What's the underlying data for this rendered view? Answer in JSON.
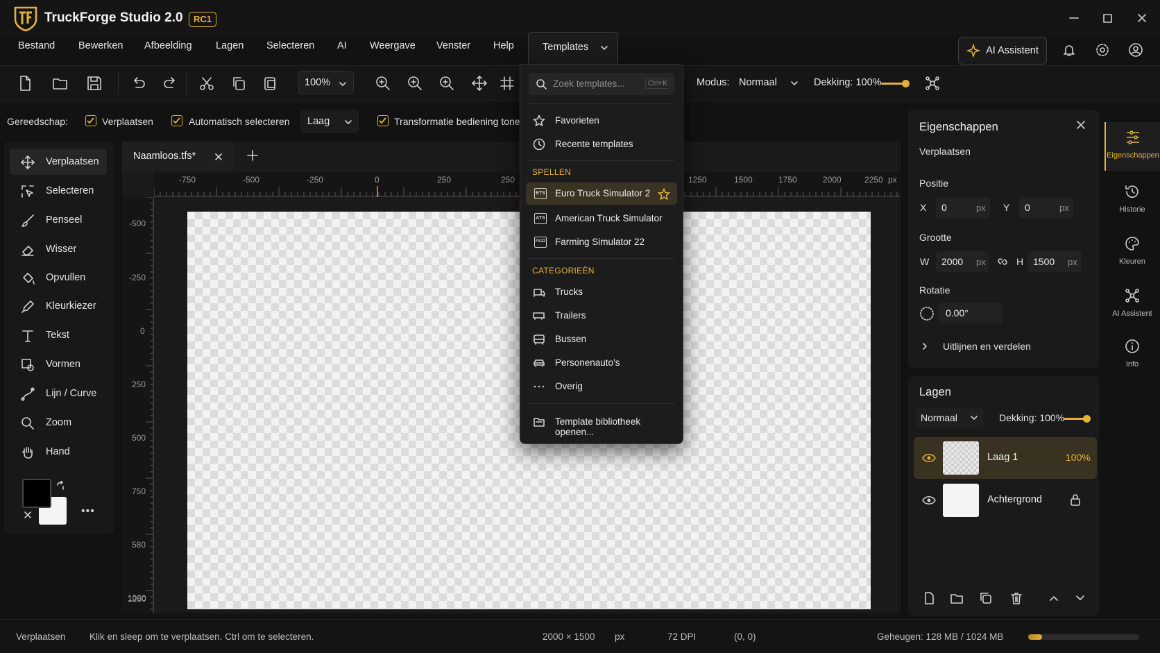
{
  "app": {
    "title": "TruckForge Studio 2.0",
    "badge": "RC1"
  },
  "menu": {
    "items": [
      "Bestand",
      "Bewerken",
      "Afbeelding",
      "Lagen",
      "Selecteren",
      "AI",
      "Weergave",
      "Venster",
      "Help"
    ],
    "templates_label": "Templates",
    "ai_assistant_label": "AI Assistent"
  },
  "toolbar": {
    "zoom_value": "100%",
    "modus_label": "Modus:",
    "modus_value": "Normaal",
    "dekking_label": "Dekking:",
    "dekking_value": "100%",
    "dekking_level": 1.0
  },
  "options": {
    "tool_label": "Gereedschap:",
    "move_label": "Verplaatsen",
    "auto_select_label": "Automatisch selecteren",
    "target_value": "Laag",
    "transform_label": "Transformatie bediening tonen"
  },
  "tools": [
    {
      "label": "Verplaatsen",
      "icon": "move-icon",
      "active": true
    },
    {
      "label": "Selecteren",
      "icon": "select-icon",
      "active": false
    },
    {
      "label": "Penseel",
      "icon": "brush-icon",
      "active": false
    },
    {
      "label": "Wisser",
      "icon": "eraser-icon",
      "active": false
    },
    {
      "label": "Opvullen",
      "icon": "fill-icon",
      "active": false
    },
    {
      "label": "Kleurkiezer",
      "icon": "eyedropper-icon",
      "active": false
    },
    {
      "label": "Tekst",
      "icon": "text-icon",
      "active": false
    },
    {
      "label": "Vormen",
      "icon": "shapes-icon",
      "active": false
    },
    {
      "label": "Lijn / Curve",
      "icon": "curve-icon",
      "active": false
    },
    {
      "label": "Zoom",
      "icon": "zoom-icon",
      "active": false
    },
    {
      "label": "Hand",
      "icon": "hand-icon",
      "active": false
    }
  ],
  "colors": {
    "foreground": "#000000",
    "background": "#f4f4f4",
    "accent": "#e5b13a"
  },
  "document": {
    "tab_label": "Naamloos.tfs*",
    "h_ruler": [
      "-750",
      "-500",
      "-250",
      "0",
      "250",
      "250",
      "1250",
      "1500",
      "1750",
      "2000",
      "2250"
    ],
    "h_ruler_unit": "px",
    "v_ruler": [
      "-500",
      "-250",
      "0",
      "250",
      "500",
      "750",
      "580",
      "1000",
      "1250"
    ]
  },
  "templates_dropdown": {
    "search_placeholder": "Zoek templates...",
    "shortcut": "Ctrl+K",
    "quick": [
      {
        "label": "Favorieten",
        "icon": "star-icon"
      },
      {
        "label": "Recente templates",
        "icon": "clock-icon"
      }
    ],
    "games_heading": "SPELLEN",
    "games": [
      {
        "label": "Euro Truck Simulator 2",
        "abbr": "ETS",
        "highlighted": true
      },
      {
        "label": "American Truck Simulator",
        "abbr": "ATS",
        "highlighted": false
      },
      {
        "label": "Farming Simulator 22",
        "abbr": "FS22",
        "highlighted": false
      }
    ],
    "categories_heading": "CATEGORIEËN",
    "categories": [
      {
        "label": "Trucks",
        "icon": "truck-icon"
      },
      {
        "label": "Trailers",
        "icon": "trailer-icon"
      },
      {
        "label": "Bussen",
        "icon": "bus-icon"
      },
      {
        "label": "Personenauto's",
        "icon": "car-icon"
      },
      {
        "label": "Overig",
        "icon": "more-icon"
      }
    ],
    "open_library_label": "Template bibliotheek openen..."
  },
  "properties": {
    "title": "Eigenschappen",
    "tool_name": "Verplaatsen",
    "position_label": "Positie",
    "x_label": "X",
    "x_value": "0",
    "y_label": "Y",
    "y_value": "0",
    "size_label": "Grootte",
    "w_label": "W",
    "w_value": "2000",
    "h_label": "H",
    "h_value": "1500",
    "unit": "px",
    "rotation_label": "Rotatie",
    "rotation_value": "0.00°",
    "align_label": "Uitlijnen en verdelen"
  },
  "layers": {
    "title": "Lagen",
    "blend_mode": "Normaal",
    "opacity_label": "Dekking:",
    "opacity_value": "100%",
    "items": [
      {
        "name": "Laag 1",
        "opacity": "100%",
        "selected": true
      },
      {
        "name": "Achtergrond",
        "opacity": "",
        "selected": false,
        "locked": true
      }
    ]
  },
  "sidebar": [
    {
      "label": "Eigenschappen",
      "icon": "properties-icon",
      "active": true
    },
    {
      "label": "Historie",
      "icon": "history-icon",
      "active": false
    },
    {
      "label": "Kleuren",
      "icon": "palette-icon",
      "active": false
    },
    {
      "label": "AI Assistent",
      "icon": "ai-nodes-icon",
      "active": false
    },
    {
      "label": "Info",
      "icon": "info-icon",
      "active": false
    }
  ],
  "status": {
    "tool": "Verplaatsen",
    "hint": "Klik en sleep om te verplaatsen. Ctrl om te selecteren.",
    "dimensions": "2000 × 1500",
    "unit": "px",
    "dpi": "72 DPI",
    "coords": "(0, 0)",
    "memory": "Geheugen: 128 MB / 1024 MB",
    "memory_fraction": 0.125
  }
}
